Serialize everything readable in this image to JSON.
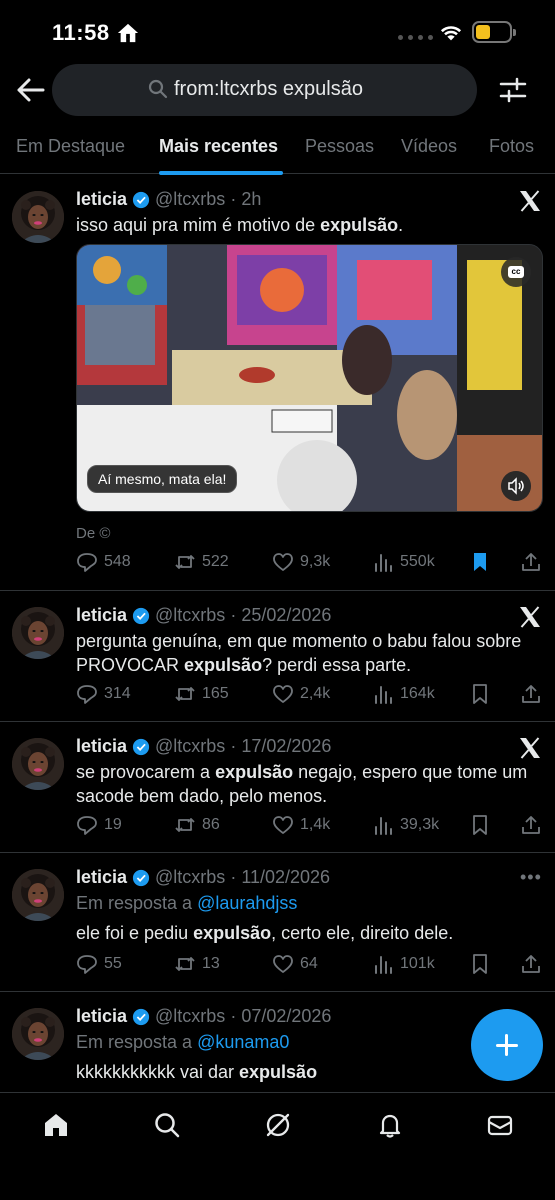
{
  "status_bar": {
    "time": "11:58"
  },
  "search": {
    "query": "from:ltcxrbs expulsão"
  },
  "tabs": [
    {
      "label": "Em Destaque",
      "active": false
    },
    {
      "label": "Mais recentes",
      "active": true
    },
    {
      "label": "Pessoas",
      "active": false
    },
    {
      "label": "Vídeos",
      "active": false
    },
    {
      "label": "Fotos",
      "active": false
    }
  ],
  "colors": {
    "accent": "#1d9bf0",
    "background": "#000000",
    "muted": "#71767b",
    "text": "#e7e9ea"
  },
  "tweets": [
    {
      "name": "leticia",
      "handle": "@ltcxrbs",
      "time": "2h",
      "text_before": "isso aqui pra mim é motivo de ",
      "text_bold": "expulsão",
      "text_after": ".",
      "media_caption": "Aí mesmo, mata ela!",
      "media_credit": "De ©",
      "replies": "548",
      "retweets": "522",
      "likes": "9,3k",
      "views": "550k",
      "bookmarked": true
    },
    {
      "name": "leticia",
      "handle": "@ltcxrbs",
      "time": "25/02/2026",
      "text_before": "pergunta genuína, em que momento o babu falou sobre PROVOCAR ",
      "text_bold": "expulsão",
      "text_after": "? perdi essa parte.",
      "replies": "314",
      "retweets": "165",
      "likes": "2,4k",
      "views": "164k",
      "bookmarked": false
    },
    {
      "name": "leticia",
      "handle": "@ltcxrbs",
      "time": "17/02/2026",
      "text_before": "se provocarem a ",
      "text_bold": "expulsão",
      "text_after": " negajo, espero que tome um sacode bem dado, pelo menos.",
      "replies": "19",
      "retweets": "86",
      "likes": "1,4k",
      "views": "39,3k",
      "bookmarked": false
    },
    {
      "name": "leticia",
      "handle": "@ltcxrbs",
      "time": "11/02/2026",
      "reply_prefix": "Em resposta a ",
      "reply_mention": "@laurahdjss",
      "text_before": "ele foi e pediu ",
      "text_bold": "expulsão",
      "text_after": ", certo ele, direito dele.",
      "replies": "55",
      "retweets": "13",
      "likes": "64",
      "views": "101k",
      "bookmarked": false
    },
    {
      "name": "leticia",
      "handle": "@ltcxrbs",
      "time": "07/02/2026",
      "reply_prefix": "Em resposta a ",
      "reply_mention": "@kunama0",
      "text_before": "kkkkkkkkkkk vai dar ",
      "text_bold": "expulsão",
      "text_after": ""
    }
  ],
  "icons": {
    "status": [
      "home-icon",
      "wifi-icon",
      "battery-icon"
    ],
    "header": [
      "back-arrow-icon",
      "search-icon",
      "filter-sliders-icon"
    ],
    "tweet_actions": [
      "reply-icon",
      "retweet-icon",
      "like-icon",
      "views-icon",
      "bookmark-icon",
      "share-icon"
    ],
    "bottom_nav": [
      "home-icon",
      "search-icon",
      "grok-icon",
      "notifications-icon",
      "messages-icon"
    ]
  }
}
